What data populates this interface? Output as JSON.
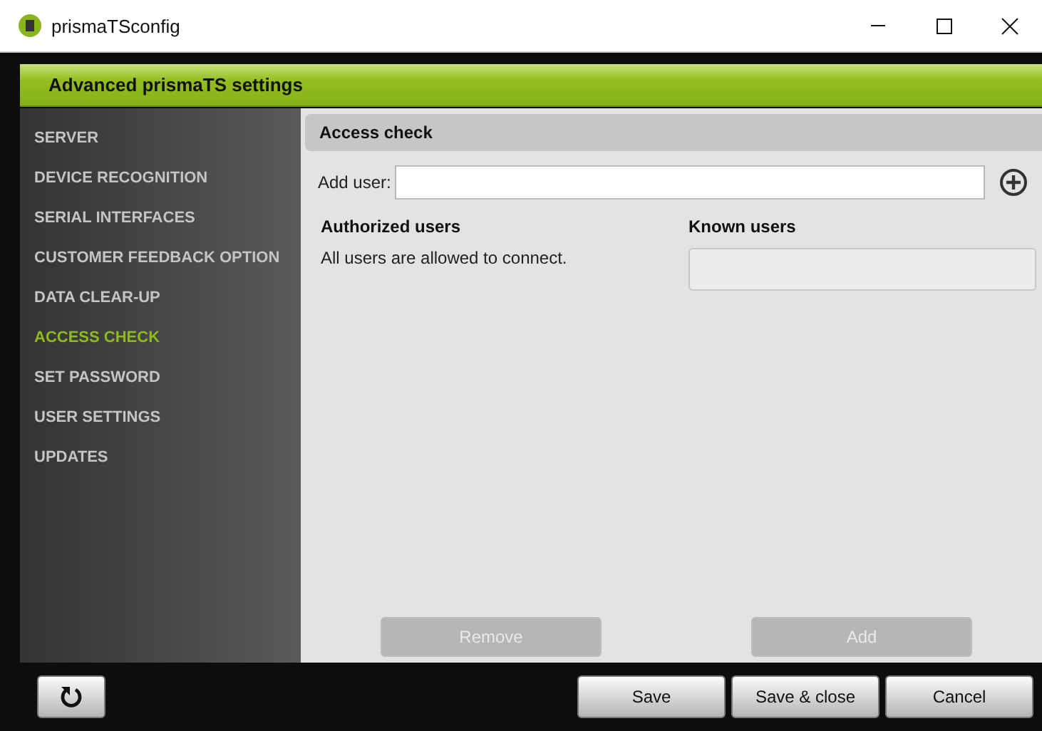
{
  "window": {
    "title": "prismaTSconfig"
  },
  "header": {
    "title": "Advanced prismaTS settings"
  },
  "sidebar": {
    "items": [
      {
        "label": "SERVER",
        "selected": false
      },
      {
        "label": "DEVICE RECOGNITION",
        "selected": false
      },
      {
        "label": "SERIAL INTERFACES",
        "selected": false
      },
      {
        "label": "CUSTOMER FEEDBACK OPTION",
        "selected": false
      },
      {
        "label": "DATA CLEAR-UP",
        "selected": false
      },
      {
        "label": "ACCESS CHECK",
        "selected": true
      },
      {
        "label": "SET PASSWORD",
        "selected": false
      },
      {
        "label": "USER SETTINGS",
        "selected": false
      },
      {
        "label": "UPDATES",
        "selected": false
      }
    ]
  },
  "panel": {
    "title": "Access check",
    "add_user": {
      "label": "Add user:"
    },
    "authorized": {
      "heading": "Authorized users",
      "message": "All users are allowed to connect."
    },
    "known": {
      "heading": "Known users"
    },
    "buttons": [
      {
        "label": "Remove",
        "disabled": true
      },
      {
        "label": "Add",
        "disabled": true
      }
    ]
  },
  "footer": {
    "buttons": [
      "Save",
      "Save & close",
      "Cancel"
    ]
  }
}
